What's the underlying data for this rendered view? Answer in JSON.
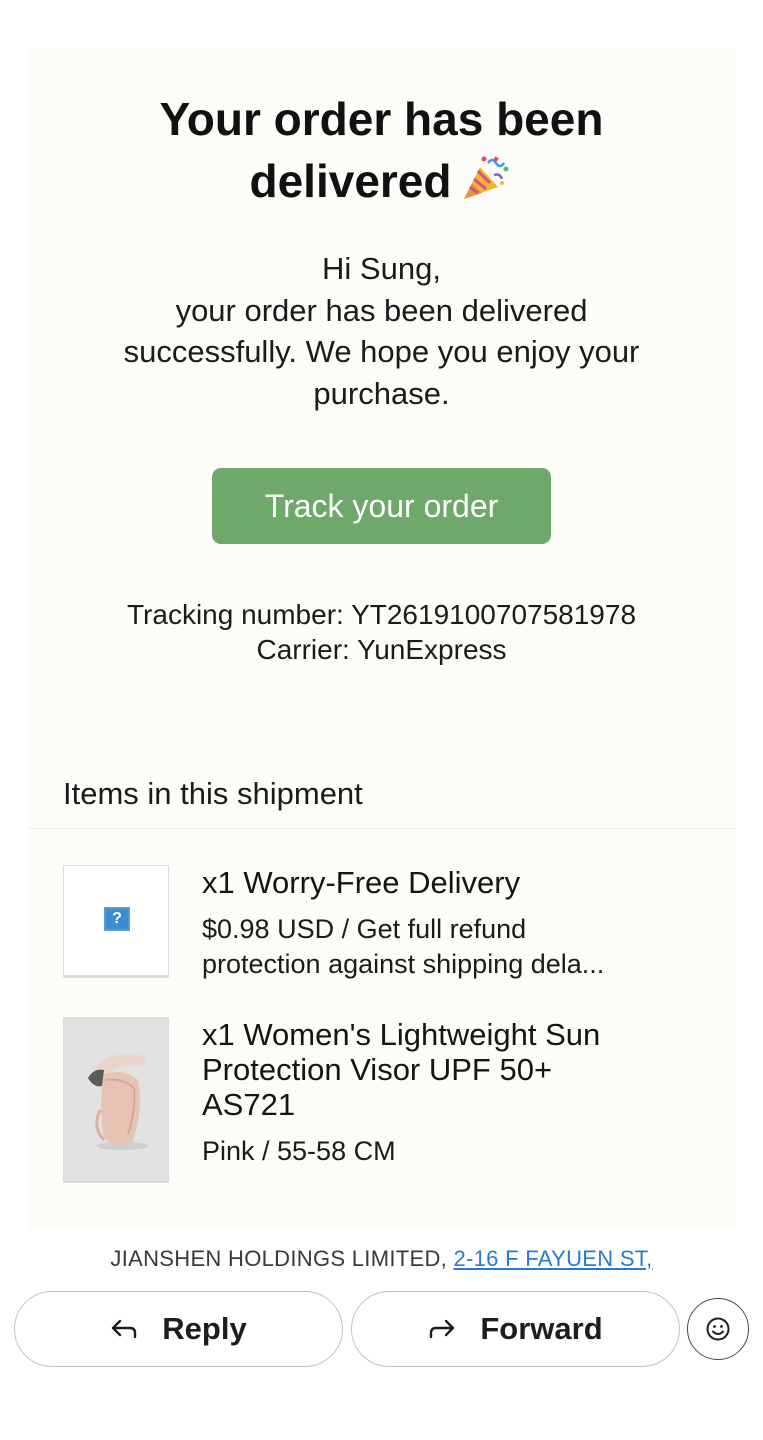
{
  "email": {
    "headline": "Your order has been delivered",
    "greeting": "Hi Sung,",
    "body": "your order has been delivered successfully. We hope you enjoy your purchase.",
    "track_button_label": "Track your order",
    "tracking_line": "Tracking number: YT2619100707581978",
    "carrier_line": "Carrier: YunExpress",
    "items_heading": "Items in this shipment",
    "items": [
      {
        "title": "x1 Worry-Free Delivery",
        "subtitle": "$0.98 USD / Get full refund protection against shipping dela...",
        "thumbnail": "broken-image-icon"
      },
      {
        "title": "x1 Women's Lightweight Sun Protection Visor UPF 50+ AS721",
        "subtitle": "Pink / 55-58 CM",
        "thumbnail": "sun-visor-product-photo"
      }
    ],
    "footer_company": "JIANSHEN HOLDINGS LIMITED,",
    "footer_address_link": "2-16 F FAYUEN ST,"
  },
  "actions": {
    "reply_label": "Reply",
    "forward_label": "Forward",
    "reply_icon": "reply-arrow-icon",
    "forward_icon": "forward-arrow-icon",
    "emoji_icon": "smiley-icon"
  },
  "colors": {
    "card_background": "#fdfcf8",
    "track_button": "#6ea86a",
    "link": "#2a78d6"
  }
}
